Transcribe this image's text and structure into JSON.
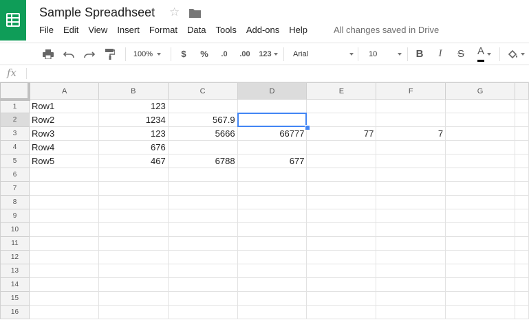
{
  "header": {
    "title": "Sample Spreadhseet",
    "saved_status": "All changes saved in Drive",
    "accent_color": "#0f9d58"
  },
  "menu": [
    "File",
    "Edit",
    "View",
    "Insert",
    "Format",
    "Data",
    "Tools",
    "Add-ons",
    "Help"
  ],
  "toolbar": {
    "zoom": "100%",
    "currency": "$",
    "percent": "%",
    "decrease_decimals": ".0",
    "increase_decimals": ".00",
    "more_formats": "123",
    "font": "Arial",
    "font_size": "10",
    "bold": "B",
    "italic": "I",
    "strikethrough": "S",
    "text_color_glyph": "A",
    "text_color": "#000000"
  },
  "formula_bar": {
    "fx_label": "fx",
    "value": ""
  },
  "grid": {
    "columns": [
      "A",
      "B",
      "C",
      "D",
      "E",
      "F",
      "G"
    ],
    "selected_cell": "D2",
    "rows": [
      {
        "n": "1",
        "cells": [
          "Row1",
          "123",
          "",
          "",
          "",
          "",
          ""
        ]
      },
      {
        "n": "2",
        "cells": [
          "Row2",
          "1234",
          "567.9",
          "",
          "",
          "",
          ""
        ]
      },
      {
        "n": "3",
        "cells": [
          "Row3",
          "123",
          "5666",
          "66777",
          "77",
          "7",
          ""
        ]
      },
      {
        "n": "4",
        "cells": [
          "Row4",
          "676",
          "",
          "",
          "",
          "",
          ""
        ]
      },
      {
        "n": "5",
        "cells": [
          "Row5",
          "467",
          "6788",
          "677",
          "",
          "",
          ""
        ]
      },
      {
        "n": "6",
        "cells": [
          "",
          "",
          "",
          "",
          "",
          "",
          ""
        ]
      },
      {
        "n": "7",
        "cells": [
          "",
          "",
          "",
          "",
          "",
          "",
          ""
        ]
      },
      {
        "n": "8",
        "cells": [
          "",
          "",
          "",
          "",
          "",
          "",
          ""
        ]
      },
      {
        "n": "9",
        "cells": [
          "",
          "",
          "",
          "",
          "",
          "",
          ""
        ]
      },
      {
        "n": "10",
        "cells": [
          "",
          "",
          "",
          "",
          "",
          "",
          ""
        ]
      },
      {
        "n": "11",
        "cells": [
          "",
          "",
          "",
          "",
          "",
          "",
          ""
        ]
      },
      {
        "n": "12",
        "cells": [
          "",
          "",
          "",
          "",
          "",
          "",
          ""
        ]
      },
      {
        "n": "13",
        "cells": [
          "",
          "",
          "",
          "",
          "",
          "",
          ""
        ]
      },
      {
        "n": "14",
        "cells": [
          "",
          "",
          "",
          "",
          "",
          "",
          ""
        ]
      },
      {
        "n": "15",
        "cells": [
          "",
          "",
          "",
          "",
          "",
          "",
          ""
        ]
      },
      {
        "n": "16",
        "cells": [
          "",
          "",
          "",
          "",
          "",
          "",
          ""
        ]
      }
    ]
  }
}
